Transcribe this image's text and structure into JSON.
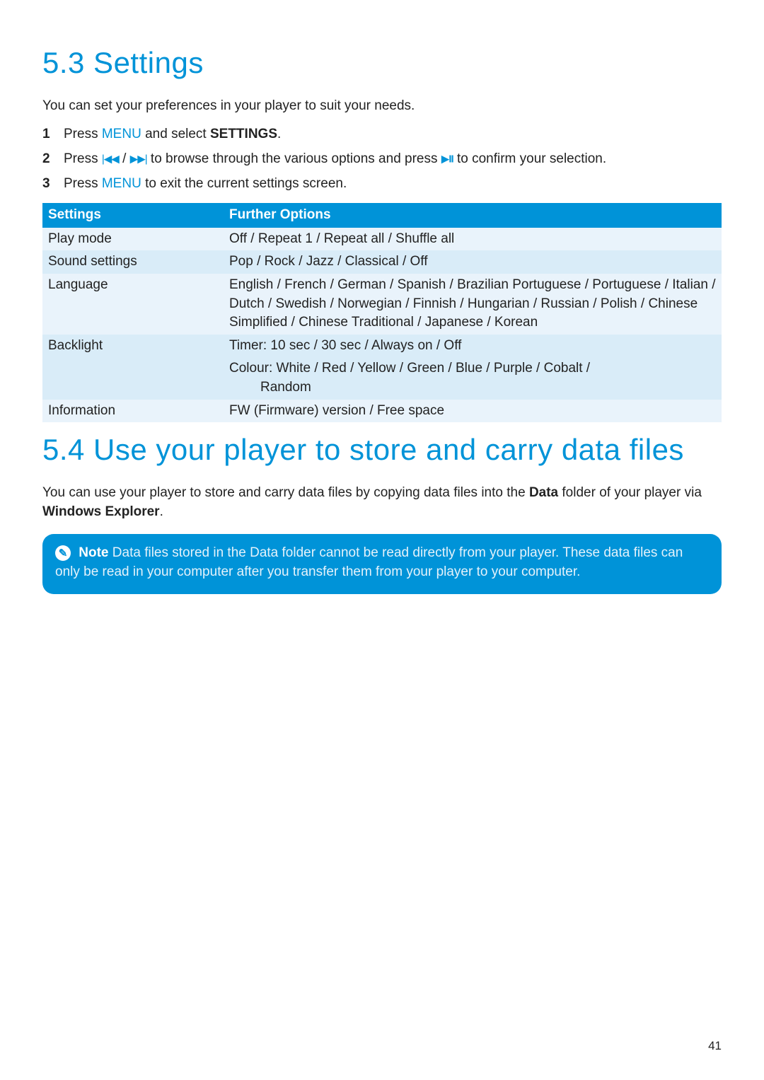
{
  "section53": {
    "heading": "5.3  Settings",
    "intro": "You can set your preferences in your player to suit your needs.",
    "steps": [
      {
        "num": "1",
        "pre": "Press ",
        "menu": "MENU",
        "mid": " and select ",
        "bold": "SETTINGS",
        "post": "."
      },
      {
        "num": "2",
        "pre": "Press ",
        "mid": " to browse through the various options and press ",
        "post": " to confirm your selection."
      },
      {
        "num": "3",
        "pre": "Press ",
        "menu": "MENU",
        "post": " to exit the current settings screen."
      }
    ],
    "table": {
      "headers": [
        "Settings",
        "Further Options"
      ],
      "rows": [
        {
          "c1": "Play mode",
          "c2": "Off / Repeat 1 / Repeat all / Shuffle all"
        },
        {
          "c1": "Sound settings",
          "c2": "Pop / Rock / Jazz / Classical / Off"
        },
        {
          "c1": "Language",
          "c2": "English / French / German / Spanish / Brazilian Portuguese / Portuguese / Italian / Dutch / Swedish / Norwegian / Finnish / Hungarian / Russian / Polish / Chinese Simplified / Chinese Traditional / Japanese / Korean"
        },
        {
          "c1": "Backlight",
          "c2": "Timer: 10 sec / 30 sec / Always on / Off"
        },
        {
          "c1": "",
          "c2a": "Colour: White / Red / Yellow / Green / Blue / Purple / Cobalt /",
          "c2b": "Random"
        },
        {
          "c1": "Information",
          "c2": "FW (Firmware) version / Free space"
        }
      ]
    }
  },
  "section54": {
    "heading": "5.4  Use your player to store and carry data files",
    "para_pre": "You can use your player to store and carry data files by copying data files into the ",
    "para_bold1": "Data",
    "para_mid": " folder of your player via ",
    "para_bold2": "Windows Explorer",
    "para_post": ".",
    "note": {
      "label": "Note",
      "text": " Data files stored in the Data folder cannot be read directly from your player. These data files can only be read in your computer after you transfer them from your player to your computer."
    }
  },
  "page_number": "41"
}
